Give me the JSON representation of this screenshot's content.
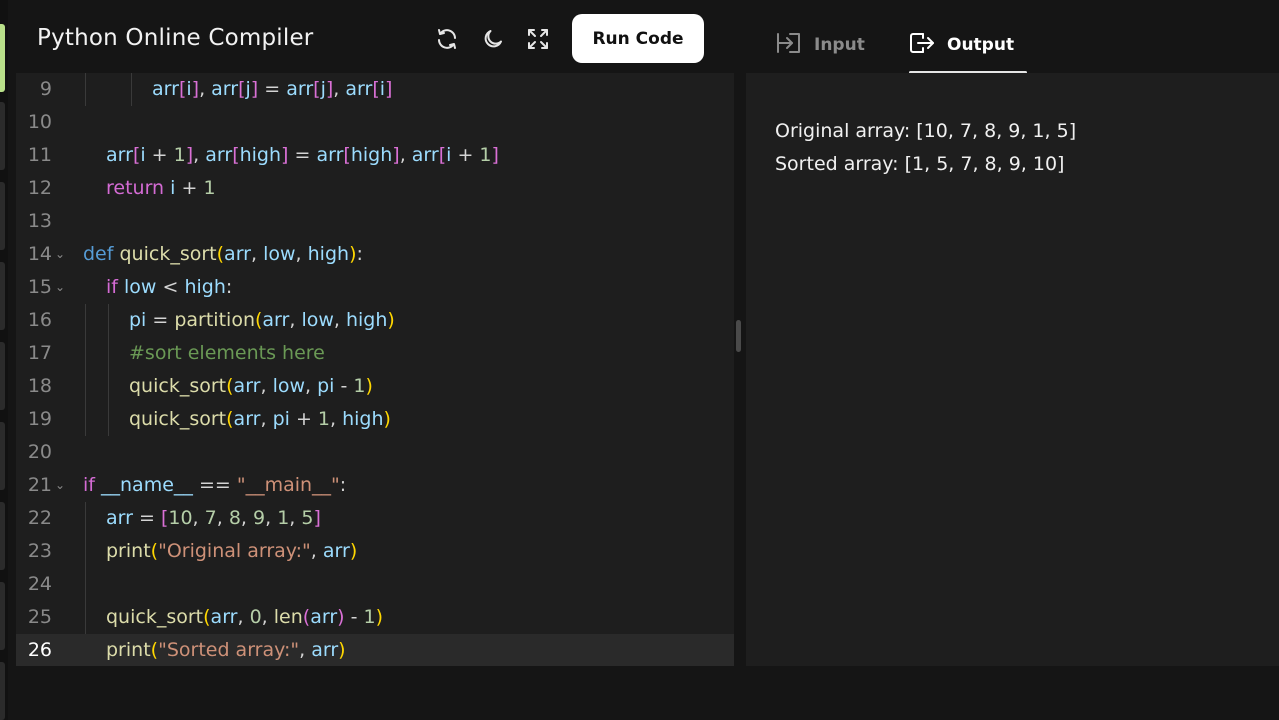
{
  "app": {
    "title": "Python Online Compiler",
    "run_label": "Run Code"
  },
  "toolbar_icons": [
    "refresh-icon",
    "moon-icon",
    "fullscreen-icon"
  ],
  "tabs": [
    {
      "label": "Input",
      "icon": "input-icon",
      "active": false
    },
    {
      "label": "Output",
      "icon": "output-icon",
      "active": true
    }
  ],
  "editor": {
    "current_line": 26,
    "lines": [
      {
        "num": "9",
        "indent": 3,
        "tokens": [
          [
            "v",
            "arr"
          ],
          [
            "p2",
            "["
          ],
          [
            "v",
            "i"
          ],
          [
            "p2",
            "]"
          ],
          [
            "o",
            ", "
          ],
          [
            "v",
            "arr"
          ],
          [
            "p2",
            "["
          ],
          [
            "v",
            "j"
          ],
          [
            "p2",
            "]"
          ],
          [
            "o",
            " = "
          ],
          [
            "v",
            "arr"
          ],
          [
            "p2",
            "["
          ],
          [
            "v",
            "j"
          ],
          [
            "p2",
            "]"
          ],
          [
            "o",
            ", "
          ],
          [
            "v",
            "arr"
          ],
          [
            "p2",
            "["
          ],
          [
            "v",
            "i"
          ],
          [
            "p2",
            "]"
          ]
        ]
      },
      {
        "num": "10",
        "indent": 0,
        "tokens": []
      },
      {
        "num": "11",
        "indent": 1,
        "tokens": [
          [
            "v",
            "arr"
          ],
          [
            "p2",
            "["
          ],
          [
            "v",
            "i"
          ],
          [
            "o",
            " + "
          ],
          [
            "n",
            "1"
          ],
          [
            "p2",
            "]"
          ],
          [
            "o",
            ", "
          ],
          [
            "v",
            "arr"
          ],
          [
            "p2",
            "["
          ],
          [
            "v",
            "high"
          ],
          [
            "p2",
            "]"
          ],
          [
            "o",
            " = "
          ],
          [
            "v",
            "arr"
          ],
          [
            "p2",
            "["
          ],
          [
            "v",
            "high"
          ],
          [
            "p2",
            "]"
          ],
          [
            "o",
            ", "
          ],
          [
            "v",
            "arr"
          ],
          [
            "p2",
            "["
          ],
          [
            "v",
            "i"
          ],
          [
            "o",
            " + "
          ],
          [
            "n",
            "1"
          ],
          [
            "p2",
            "]"
          ]
        ]
      },
      {
        "num": "12",
        "indent": 1,
        "tokens": [
          [
            "k",
            "return"
          ],
          [
            "o",
            " "
          ],
          [
            "v",
            "i"
          ],
          [
            "o",
            " + "
          ],
          [
            "n",
            "1"
          ]
        ]
      },
      {
        "num": "13",
        "indent": 0,
        "tokens": []
      },
      {
        "num": "14",
        "indent": 0,
        "fold": true,
        "tokens": [
          [
            "def",
            "def"
          ],
          [
            "o",
            " "
          ],
          [
            "f",
            "quick_sort"
          ],
          [
            "p1",
            "("
          ],
          [
            "v",
            "arr"
          ],
          [
            "o",
            ", "
          ],
          [
            "v",
            "low"
          ],
          [
            "o",
            ", "
          ],
          [
            "v",
            "high"
          ],
          [
            "p1",
            ")"
          ],
          [
            "o",
            ":"
          ]
        ]
      },
      {
        "num": "15",
        "indent": 1,
        "fold": true,
        "tokens": [
          [
            "k",
            "if"
          ],
          [
            "o",
            " "
          ],
          [
            "v",
            "low"
          ],
          [
            "o",
            " < "
          ],
          [
            "v",
            "high"
          ],
          [
            "o",
            ":"
          ]
        ]
      },
      {
        "num": "16",
        "indent": 2,
        "tokens": [
          [
            "v",
            "pi"
          ],
          [
            "o",
            " = "
          ],
          [
            "f",
            "partition"
          ],
          [
            "p1",
            "("
          ],
          [
            "v",
            "arr"
          ],
          [
            "o",
            ", "
          ],
          [
            "v",
            "low"
          ],
          [
            "o",
            ", "
          ],
          [
            "v",
            "high"
          ],
          [
            "p1",
            ")"
          ]
        ]
      },
      {
        "num": "17",
        "indent": 2,
        "tokens": [
          [
            "c",
            "#sort elements here"
          ]
        ]
      },
      {
        "num": "18",
        "indent": 2,
        "tokens": [
          [
            "f",
            "quick_sort"
          ],
          [
            "p1",
            "("
          ],
          [
            "v",
            "arr"
          ],
          [
            "o",
            ", "
          ],
          [
            "v",
            "low"
          ],
          [
            "o",
            ", "
          ],
          [
            "v",
            "pi"
          ],
          [
            "o",
            " - "
          ],
          [
            "n",
            "1"
          ],
          [
            "p1",
            ")"
          ]
        ]
      },
      {
        "num": "19",
        "indent": 2,
        "tokens": [
          [
            "f",
            "quick_sort"
          ],
          [
            "p1",
            "("
          ],
          [
            "v",
            "arr"
          ],
          [
            "o",
            ", "
          ],
          [
            "v",
            "pi"
          ],
          [
            "o",
            " + "
          ],
          [
            "n",
            "1"
          ],
          [
            "o",
            ", "
          ],
          [
            "v",
            "high"
          ],
          [
            "p1",
            ")"
          ]
        ]
      },
      {
        "num": "20",
        "indent": 0,
        "tokens": []
      },
      {
        "num": "21",
        "indent": 0,
        "fold": true,
        "tokens": [
          [
            "k",
            "if"
          ],
          [
            "o",
            " "
          ],
          [
            "v",
            "__name__"
          ],
          [
            "o",
            " == "
          ],
          [
            "s",
            "\"__main__\""
          ],
          [
            "o",
            ":"
          ]
        ]
      },
      {
        "num": "22",
        "indent": 1,
        "tokens": [
          [
            "v",
            "arr"
          ],
          [
            "o",
            " = "
          ],
          [
            "p2",
            "["
          ],
          [
            "n",
            "10"
          ],
          [
            "o",
            ", "
          ],
          [
            "n",
            "7"
          ],
          [
            "o",
            ", "
          ],
          [
            "n",
            "8"
          ],
          [
            "o",
            ", "
          ],
          [
            "n",
            "9"
          ],
          [
            "o",
            ", "
          ],
          [
            "n",
            "1"
          ],
          [
            "o",
            ", "
          ],
          [
            "n",
            "5"
          ],
          [
            "p2",
            "]"
          ]
        ]
      },
      {
        "num": "23",
        "indent": 1,
        "tokens": [
          [
            "f",
            "print"
          ],
          [
            "p1",
            "("
          ],
          [
            "s",
            "\"Original array:\""
          ],
          [
            "o",
            ", "
          ],
          [
            "v",
            "arr"
          ],
          [
            "p1",
            ")"
          ]
        ]
      },
      {
        "num": "24",
        "indent": 0,
        "tokens": []
      },
      {
        "num": "25",
        "indent": 1,
        "tokens": [
          [
            "f",
            "quick_sort"
          ],
          [
            "p1",
            "("
          ],
          [
            "v",
            "arr"
          ],
          [
            "o",
            ", "
          ],
          [
            "n",
            "0"
          ],
          [
            "o",
            ", "
          ],
          [
            "f",
            "len"
          ],
          [
            "p2",
            "("
          ],
          [
            "v",
            "arr"
          ],
          [
            "p2",
            ")"
          ],
          [
            "o",
            " - "
          ],
          [
            "n",
            "1"
          ],
          [
            "p1",
            ")"
          ]
        ]
      },
      {
        "num": "26",
        "indent": 1,
        "tokens": [
          [
            "f",
            "print"
          ],
          [
            "p1",
            "("
          ],
          [
            "s",
            "\"Sorted array:\""
          ],
          [
            "o",
            ", "
          ],
          [
            "v",
            "arr"
          ],
          [
            "p1",
            ")"
          ]
        ]
      }
    ]
  },
  "output": {
    "lines": [
      "Original array: [10, 7, 8, 9, 1, 5]",
      "Sorted array: [1, 5, 7, 8, 9, 10]"
    ]
  }
}
